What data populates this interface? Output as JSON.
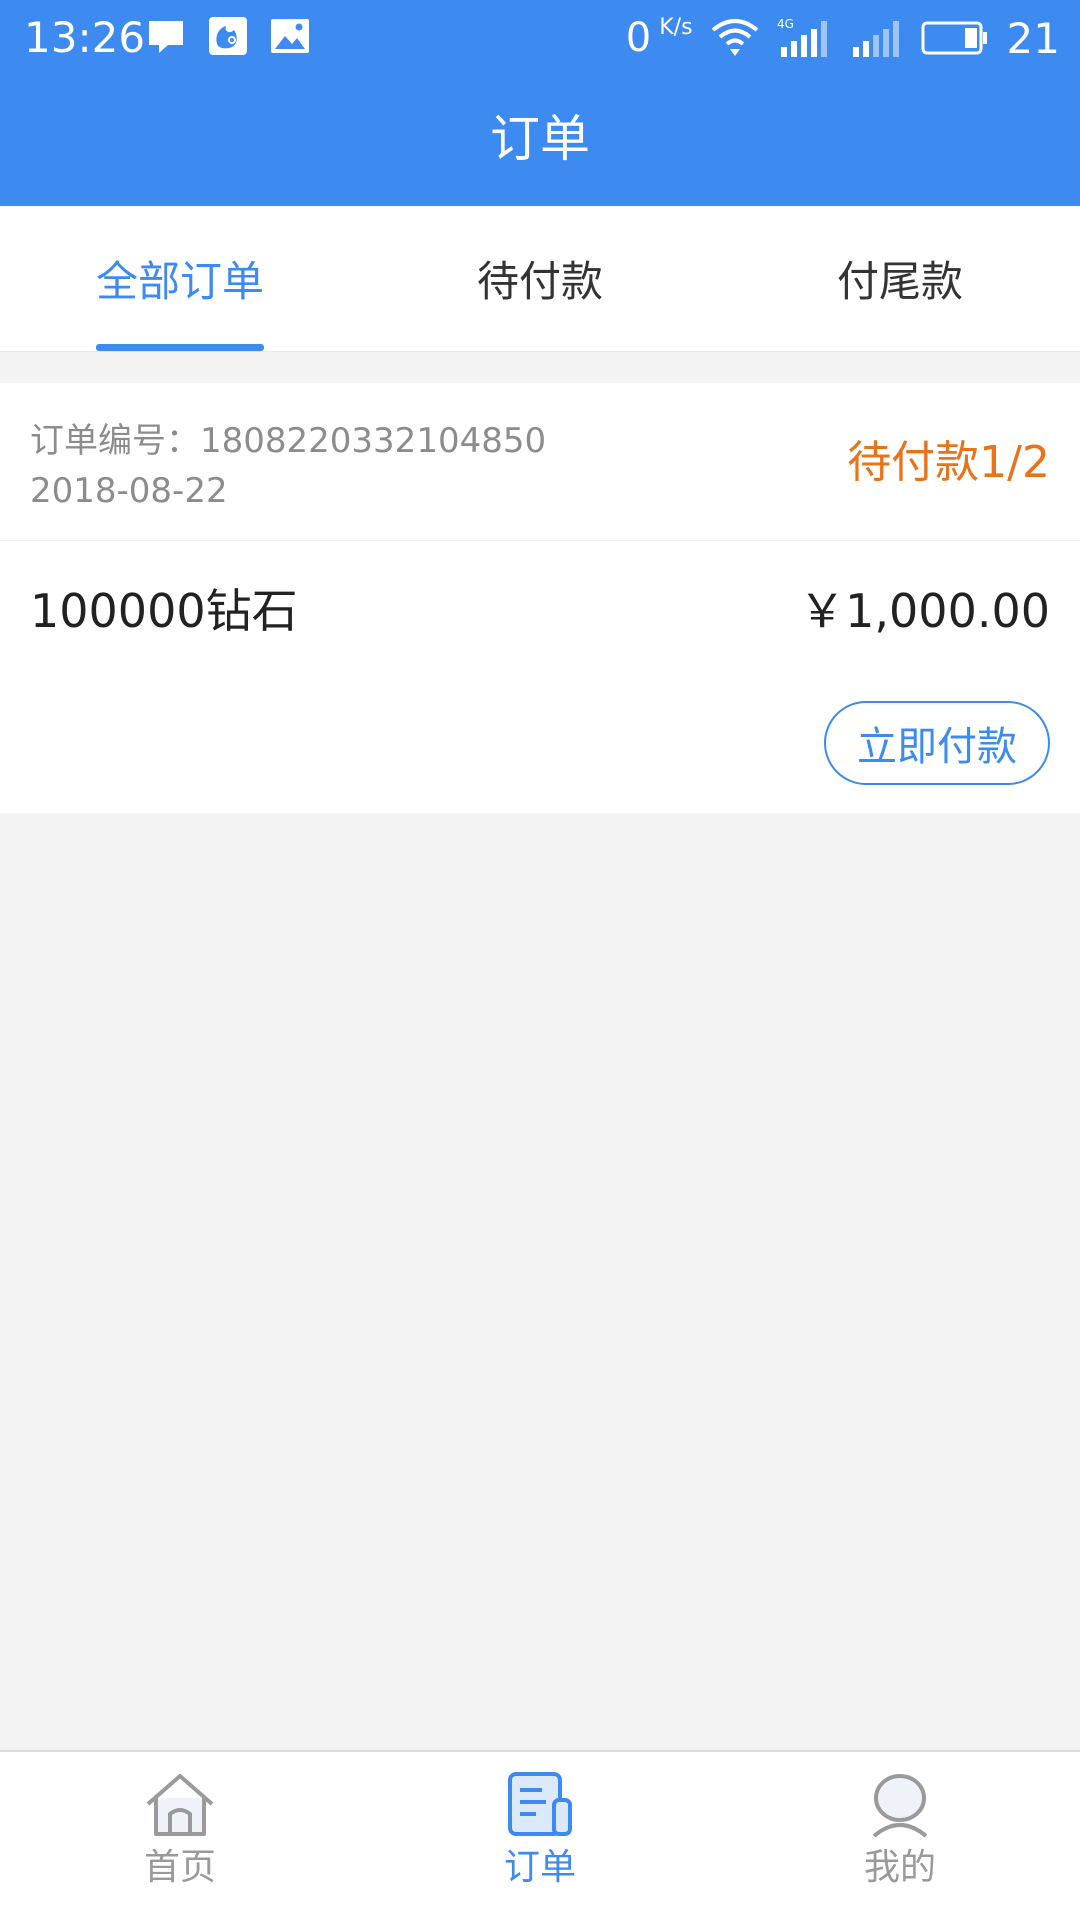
{
  "status_bar": {
    "time": "13:26",
    "net_speed": "0",
    "net_unit": "K/s",
    "network_type": "4G",
    "battery_level": "21"
  },
  "header": {
    "title": "订单"
  },
  "tabs": [
    {
      "label": "全部订单",
      "active": true
    },
    {
      "label": "待付款",
      "active": false
    },
    {
      "label": "付尾款",
      "active": false
    }
  ],
  "order": {
    "number_label": "订单编号：1808220332104850",
    "date": "2018-08-22",
    "status": "待付款1/2",
    "product": "100000钻石",
    "price": "￥1,000.00",
    "pay_button": "立即付款"
  },
  "bottom_nav": [
    {
      "label": "首页",
      "icon": "home-icon",
      "active": false
    },
    {
      "label": "订单",
      "icon": "order-icon",
      "active": true
    },
    {
      "label": "我的",
      "icon": "profile-icon",
      "active": false
    }
  ],
  "colors": {
    "primary": "#3d8af0",
    "status_orange": "#e8731a",
    "background": "#f3f3f3"
  }
}
